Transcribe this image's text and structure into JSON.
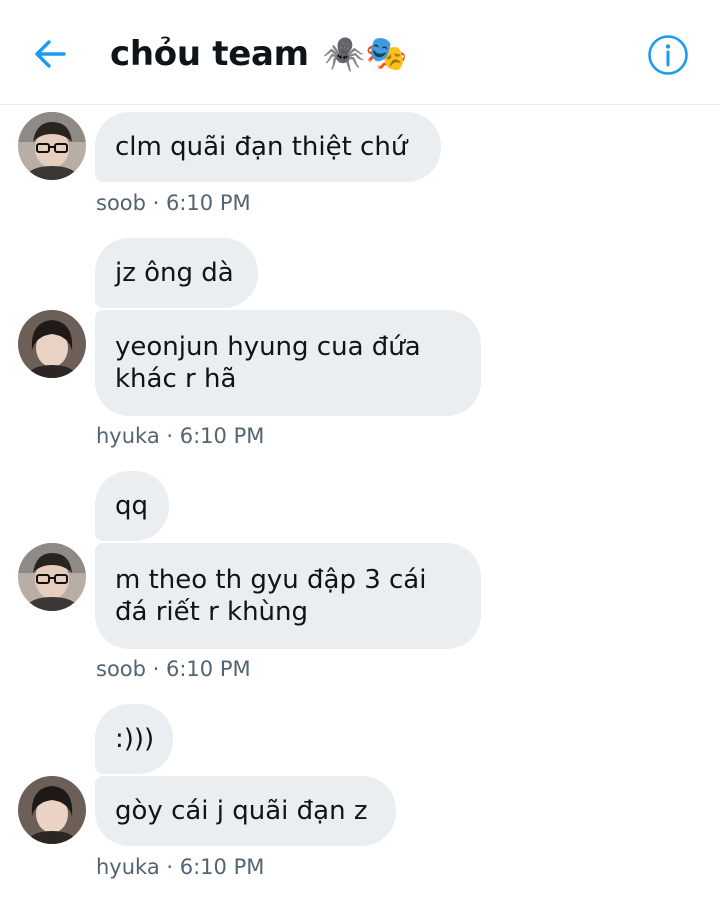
{
  "header": {
    "back_icon": "arrow-left-icon",
    "title": "chỏu team",
    "title_emoji": "🕷️🎭",
    "info_icon": "info-circle-icon",
    "accent": "#1d9bf0"
  },
  "messages": [
    {
      "bubbles": [
        "clm quãi đạn thiệt chứ"
      ],
      "sender": "soob",
      "time": "6:10 PM",
      "meta": "soob · 6:10 PM"
    },
    {
      "bubbles": [
        "jz ông dà",
        "yeonjun hyung cua đứa khác r hã"
      ],
      "sender": "hyuka",
      "time": "6:10 PM",
      "meta": "hyuka · 6:10 PM"
    },
    {
      "bubbles": [
        "qq",
        "m theo th gyu đập 3 cái đá riết r khùng"
      ],
      "sender": "soob",
      "time": "6:10 PM",
      "meta": "soob · 6:10 PM"
    },
    {
      "bubbles": [
        ":)))",
        "gòy cái j quãi đạn z"
      ],
      "sender": "hyuka",
      "time": "6:10 PM",
      "meta": "hyuka · 6:10 PM"
    }
  ],
  "colors": {
    "bubble_bg": "#ebeef0",
    "text": "#0f1419",
    "meta": "#536471"
  }
}
